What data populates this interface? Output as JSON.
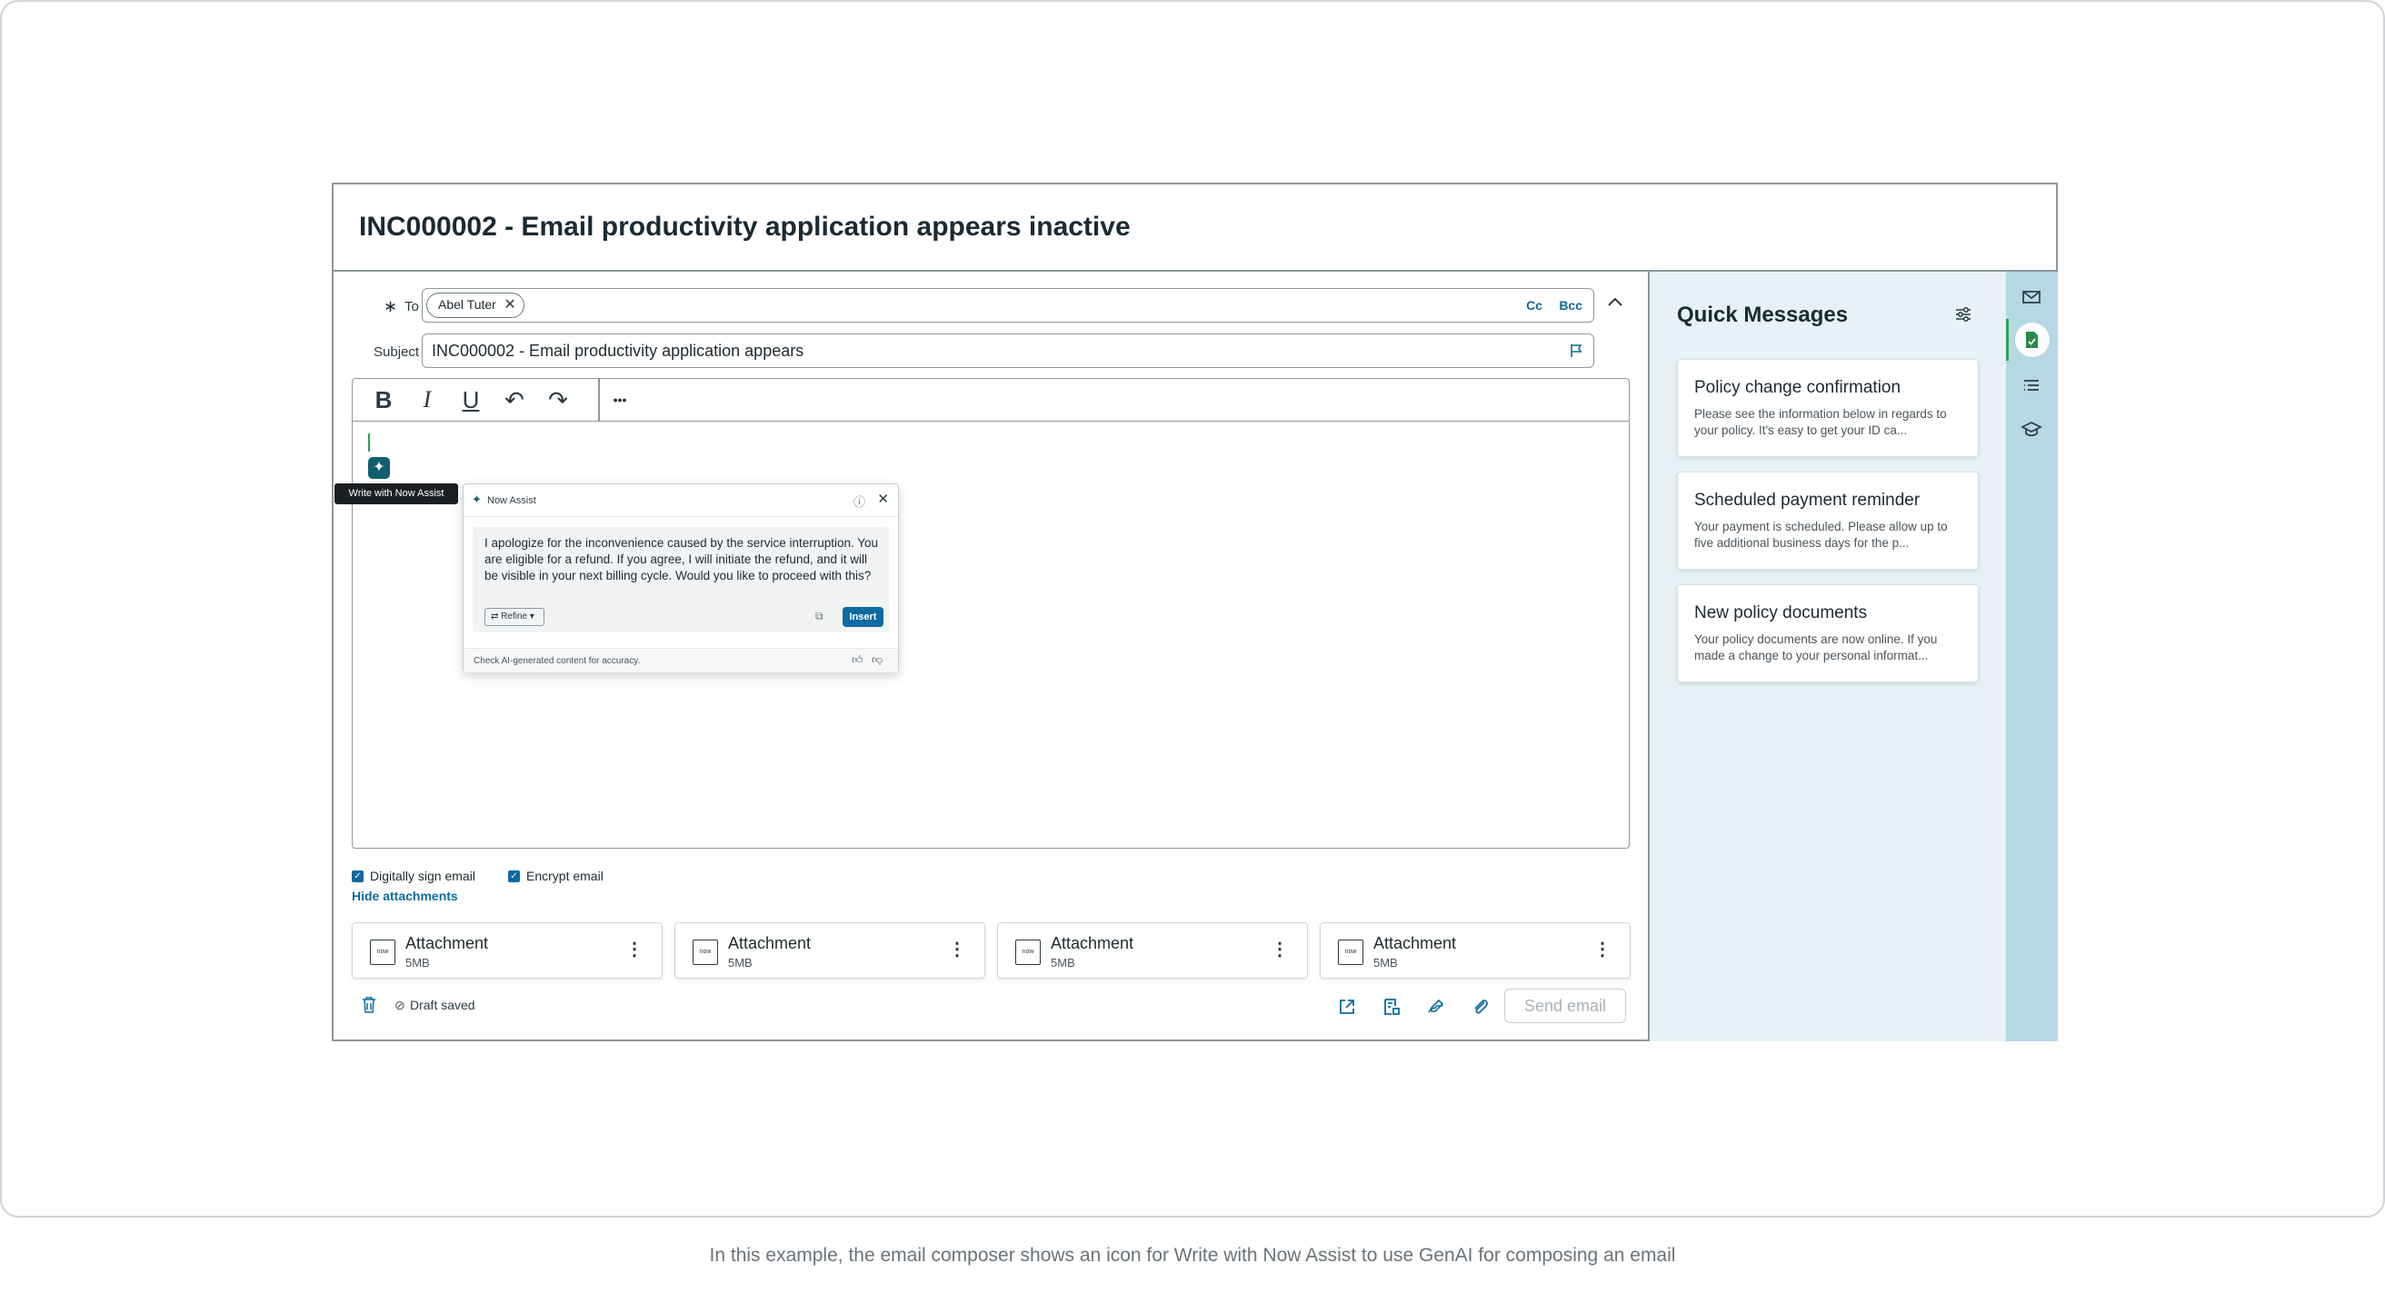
{
  "window": {
    "title": "INC000002 - Email productivity application appears inactive"
  },
  "composer": {
    "to_label": "To",
    "required_mark": "∗",
    "recipients": [
      {
        "name": "Abel Tuter"
      }
    ],
    "cc_label": "Cc",
    "bcc_label": "Bcc",
    "subject_label": "Subject",
    "subject_value": "INC000002 - Email productivity application appears",
    "toolbar": {
      "bold": "B",
      "italic": "I",
      "underline": "U",
      "undo": "↶",
      "redo": "↷",
      "more": "•••"
    },
    "now_assist_tooltip": "Write with Now Assist",
    "now_assist": {
      "title": "Now Assist",
      "response": "I apologize for the inconvenience caused by the service interruption. You are eligible for a refund. If you agree, I will initiate the refund, and it will be visible in your next billing cycle. Would you like to proceed with this?",
      "refine_label": "Refine",
      "insert_label": "Insert",
      "footer": "Check AI-generated content for accuracy."
    },
    "options": {
      "digitally_sign": "Digitally sign email",
      "encrypt": "Encrypt email"
    },
    "hide_attachments": "Hide attachments",
    "attachments": [
      {
        "name": "Attachment",
        "size": "5MB"
      },
      {
        "name": "Attachment",
        "size": "5MB"
      },
      {
        "name": "Attachment",
        "size": "5MB"
      },
      {
        "name": "Attachment",
        "size": "5MB"
      }
    ],
    "draft_status": "Draft saved",
    "send_label": "Send email"
  },
  "quick_messages": {
    "title": "Quick Messages",
    "items": [
      {
        "title": "Policy change confirmation",
        "body": "Please see the information below in regards to your policy. It's easy to get your ID ca..."
      },
      {
        "title": "Scheduled payment reminder",
        "body": "Your payment is scheduled. Please allow up to five additional business days for the p..."
      },
      {
        "title": "New policy documents",
        "body": "Your policy documents are now online. If you made a change to your personal informat..."
      }
    ]
  },
  "caption": "In this example, the email composer shows an icon for Write with Now Assist to use GenAI for composing an email",
  "colors": {
    "accent": "#0f6aa0",
    "now_assist": "#125e6f",
    "panel_bg": "#e6f2f5",
    "rail_bg": "#b6d8e2"
  }
}
